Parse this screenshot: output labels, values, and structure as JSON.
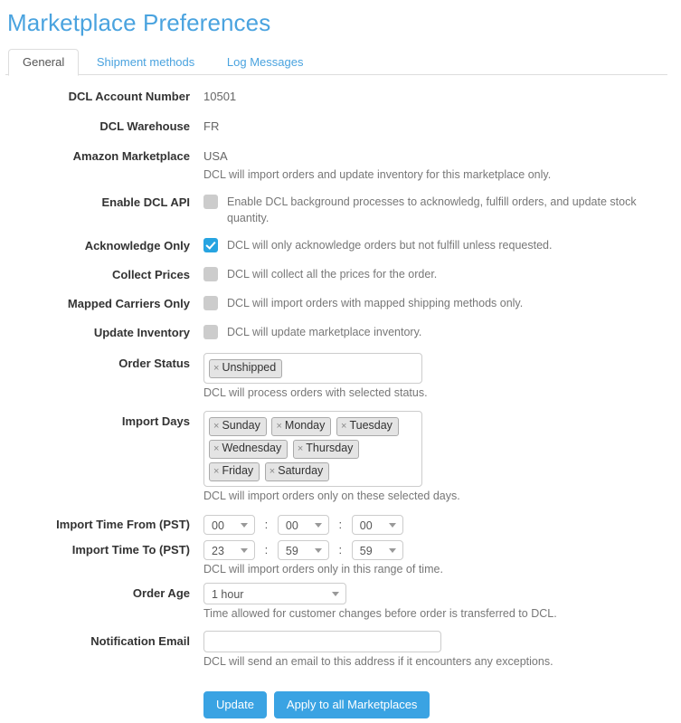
{
  "page": {
    "title": "Marketplace Preferences"
  },
  "tabs": [
    {
      "label": "General",
      "active": true
    },
    {
      "label": "Shipment methods",
      "active": false
    },
    {
      "label": "Log Messages",
      "active": false
    }
  ],
  "fields": {
    "account": {
      "label": "DCL Account Number",
      "value": "10501"
    },
    "warehouse": {
      "label": "DCL Warehouse",
      "value": "FR"
    },
    "marketplace": {
      "label": "Amazon Marketplace",
      "value": "USA",
      "help": "DCL will import orders and update inventory for this marketplace only."
    },
    "enable_api": {
      "label": "Enable DCL API",
      "checked": false,
      "text": "Enable DCL background processes to acknowledg, fulfill orders, and update stock quantity."
    },
    "acknowledge_only": {
      "label": "Acknowledge Only",
      "checked": true,
      "text": "DCL will only acknowledge orders but not fulfill unless requested."
    },
    "collect_prices": {
      "label": "Collect Prices",
      "checked": false,
      "text": "DCL will collect all the prices for the order."
    },
    "mapped_carriers": {
      "label": "Mapped Carriers Only",
      "checked": false,
      "text": "DCL will import orders with mapped shipping methods only."
    },
    "update_inventory": {
      "label": "Update Inventory",
      "checked": false,
      "text": "DCL will update marketplace inventory."
    },
    "order_status": {
      "label": "Order Status",
      "tags": [
        "Unshipped"
      ],
      "remove_glyph": "×",
      "help": "DCL will process orders with selected status."
    },
    "import_days": {
      "label": "Import Days",
      "tags": [
        "Sunday",
        "Monday",
        "Tuesday",
        "Wednesday",
        "Thursday",
        "Friday",
        "Saturday"
      ],
      "remove_glyph": "×",
      "help": "DCL will import orders only on these selected days."
    },
    "time_from": {
      "label": "Import Time From (PST)",
      "hours": "00",
      "minutes": "00",
      "seconds": "00",
      "separator": ":"
    },
    "time_to": {
      "label": "Import Time To (PST)",
      "hours": "23",
      "minutes": "59",
      "seconds": "59",
      "separator": ":",
      "help": "DCL will import orders only in this range of time."
    },
    "order_age": {
      "label": "Order Age",
      "value": "1 hour",
      "help": "Time allowed for customer changes before order is transferred to DCL."
    },
    "notification_email": {
      "label": "Notification Email",
      "value": "",
      "placeholder": "",
      "help": "DCL will send an email to this address if it encounters any exceptions."
    }
  },
  "buttons": {
    "update": "Update",
    "apply_all": "Apply to all Marketplaces"
  },
  "colors": {
    "title": "#4aa3df",
    "accent": "#3aa3e3",
    "checkbox_on": "#27a4e1",
    "checkbox_off": "#cccccc"
  }
}
